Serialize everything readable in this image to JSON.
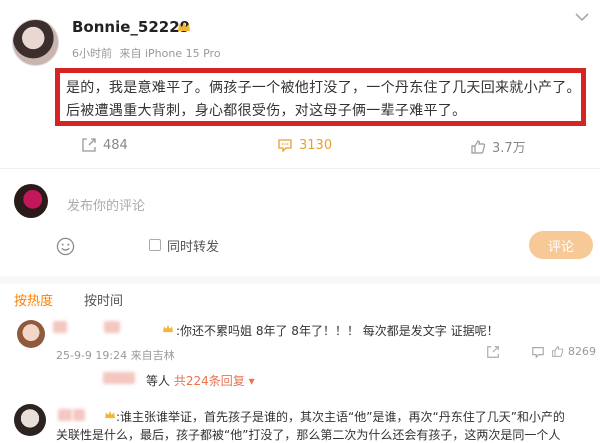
{
  "post": {
    "username": "Bonnie_52229",
    "time": "6小时前",
    "source": "来自 iPhone 15 Pro",
    "line1": "是的，我是意难平了。俩孩子一个被他打没了，一个丹东住了几天回来就小产了。",
    "line2": "后被遭遇重大背刺，身心都很受伤，对这母子俩一辈子难平了。",
    "share_count": "484",
    "comment_count": "3130",
    "like_count": "3.7万",
    "icons": {
      "share": "share-icon",
      "comment": "comment-icon",
      "like": "thumbs-up-icon",
      "vip": "crown-icon",
      "more": "chevron-down-icon"
    }
  },
  "composer": {
    "placeholder": "发布你的评论",
    "repost_label": "同时转发",
    "submit_label": "评论"
  },
  "sort": {
    "hot": "按热度",
    "time": "按时间"
  },
  "comments": [
    {
      "text": ":你还不累吗姐 8年了 8年了！！！ 每次都是发文字 证据呢！",
      "time": "25-9-9 19:24",
      "source": "来自吉林",
      "likes": "8269",
      "reply_prefix": "等人",
      "reply_link": "共224条回复 ▾"
    },
    {
      "text_line1": ":谁主张谁举证，首先孩子是谁的，其次主语“他”是谁，再次“丹东住了几天”和小产的",
      "text_line2": "关联性是什么，最后，孩子都被“他”打没了，那么第二次为什么还会有孩子，这两次是同一个人"
    }
  ],
  "colors": {
    "highlight_border": "#d62424",
    "accent_orange": "#ff8200",
    "submit_bg": "#f6c996",
    "reply_link": "#eb7350"
  }
}
